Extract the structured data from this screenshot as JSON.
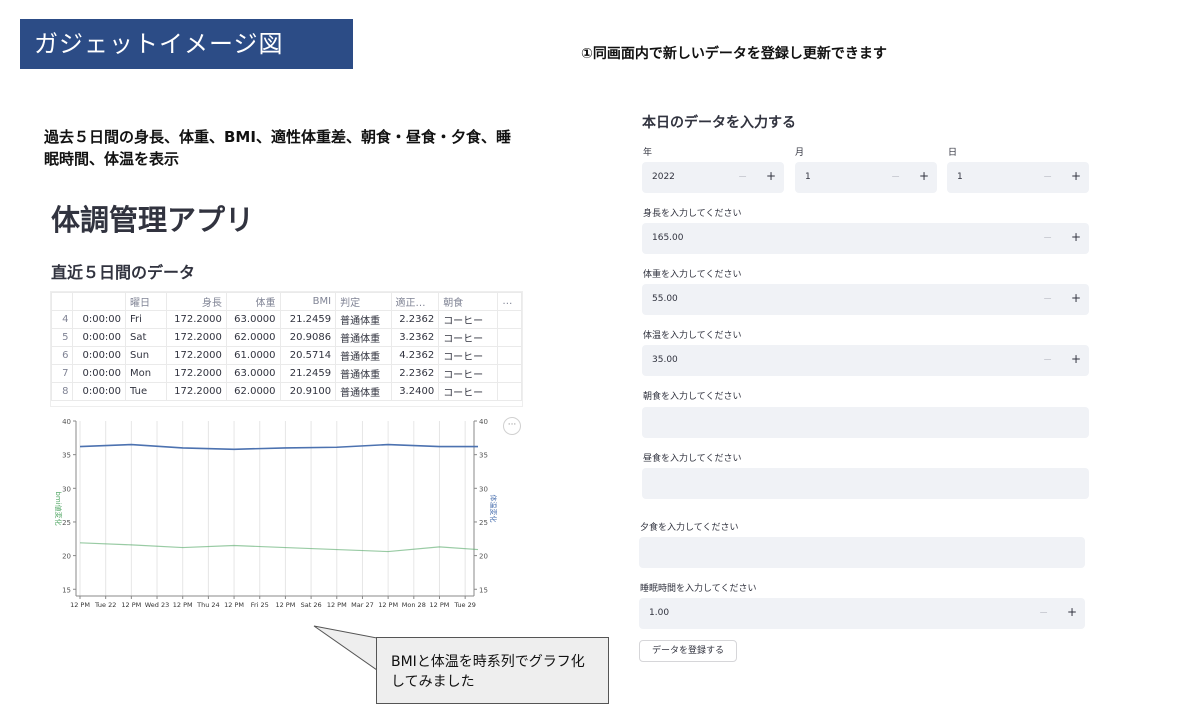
{
  "banner": "ガジェットイメージ図",
  "note_top": "①同画面内で新しいデータを登録し更新できます",
  "note_left": "過去５日間の身長、体重、BMI、適性体重差、朝食・昼食・夕食、睡眠時間、体温を表示",
  "app_title": "体調管理アプリ",
  "section_title": "直近５日間のデータ",
  "table": {
    "columns": [
      "",
      "",
      "曜日",
      "身長",
      "体重",
      "BMI",
      "判定",
      "適正…",
      "朝食",
      "…"
    ],
    "rows": [
      {
        "index": "4",
        "time": "0:00:00",
        "day": "Fri",
        "height": "172.2000",
        "weight": "63.0000",
        "bmi": "21.2459",
        "judge": "普通体重",
        "diff": "2.2362",
        "breakfast": "コーヒー"
      },
      {
        "index": "5",
        "time": "0:00:00",
        "day": "Sat",
        "height": "172.2000",
        "weight": "62.0000",
        "bmi": "20.9086",
        "judge": "普通体重",
        "diff": "3.2362",
        "breakfast": "コーヒー"
      },
      {
        "index": "6",
        "time": "0:00:00",
        "day": "Sun",
        "height": "172.2000",
        "weight": "61.0000",
        "bmi": "20.5714",
        "judge": "普通体重",
        "diff": "4.2362",
        "breakfast": "コーヒー"
      },
      {
        "index": "7",
        "time": "0:00:00",
        "day": "Mon",
        "height": "172.2000",
        "weight": "63.0000",
        "bmi": "21.2459",
        "judge": "普通体重",
        "diff": "2.2362",
        "breakfast": "コーヒー"
      },
      {
        "index": "8",
        "time": "0:00:00",
        "day": "Tue",
        "height": "172.2000",
        "weight": "62.0000",
        "bmi": "20.9100",
        "judge": "普通体重",
        "diff": "3.2400",
        "breakfast": "コーヒー"
      }
    ]
  },
  "chart_menu": "···",
  "chart_data": {
    "type": "line",
    "x_ticks": [
      "12 PM",
      "Tue 22",
      "12 PM",
      "Wed 23",
      "12 PM",
      "Thu 24",
      "12 PM",
      "Fri 25",
      "12 PM",
      "Sat 26",
      "12 PM",
      "Mar 27",
      "12 PM",
      "Mon 28",
      "12 PM",
      "Tue 29"
    ],
    "ylim": [
      14,
      40
    ],
    "y_ticks": [
      15,
      20,
      25,
      30,
      35,
      40
    ],
    "ylabel_left": "bmi値変化",
    "ylabel_right": "体温変化",
    "series": [
      {
        "axis": "right",
        "color": "#4c72b0",
        "x": [
          0,
          2,
          4,
          6,
          8,
          10,
          12,
          14,
          15.5
        ],
        "values": [
          36.2,
          36.5,
          36.0,
          35.8,
          36.0,
          36.1,
          36.5,
          36.2,
          36.2
        ]
      },
      {
        "axis": "left",
        "color": "#55a868",
        "x": [
          0,
          2,
          4,
          6,
          8,
          10,
          12,
          14,
          15.5
        ],
        "values": [
          21.9,
          21.6,
          21.2,
          21.5,
          21.2,
          20.9,
          20.6,
          21.3,
          20.9
        ]
      }
    ]
  },
  "callout": "BMIと体温を時系列でグラフ化してみました",
  "form": {
    "title": "本日のデータを入力する",
    "year_label": "年",
    "year_value": "2022",
    "month_label": "月",
    "month_value": "1",
    "day_label": "日",
    "day_value": "1",
    "height_label": "身長を入力してください",
    "height_value": "165.00",
    "weight_label": "体重を入力してください",
    "weight_value": "55.00",
    "temp_label": "体温を入力してください",
    "temp_value": "35.00",
    "breakfast_label": "朝食を入力してください",
    "lunch_label": "昼食を入力してください",
    "dinner_label": "夕食を入力してください",
    "sleep_label": "睡眠時間を入力してください",
    "sleep_value": "1.00",
    "minus": "−",
    "plus": "+",
    "submit_label": "データを登録する"
  }
}
